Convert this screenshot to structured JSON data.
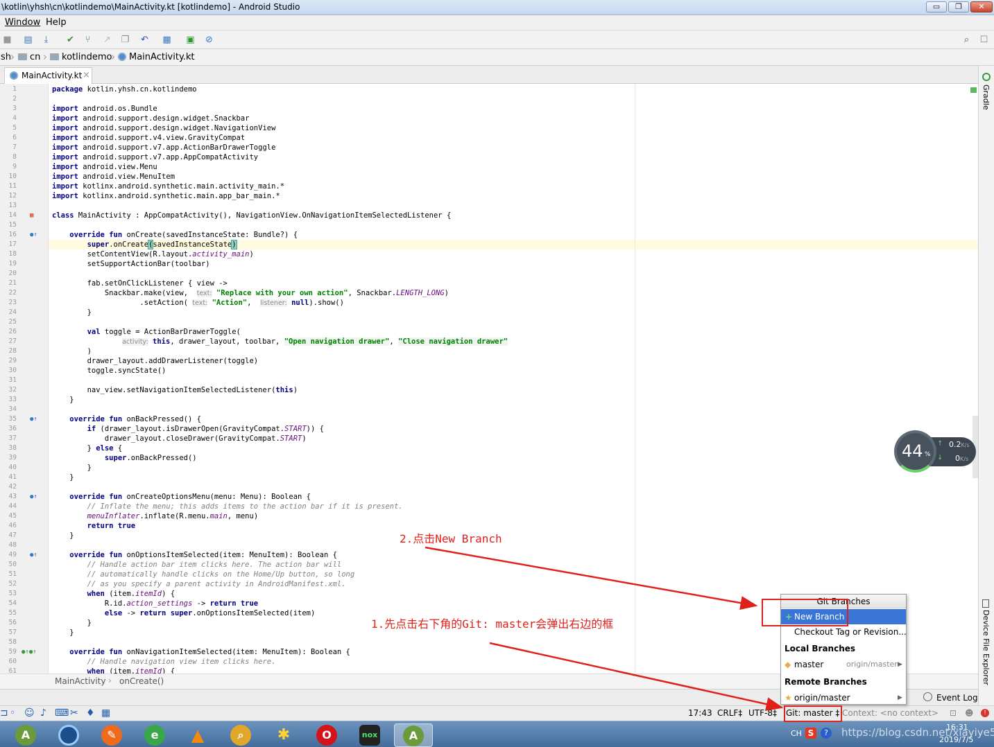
{
  "window": {
    "title": "\\kotlin\\yhsh\\cn\\kotlindemo\\MainActivity.kt [kotlindemo] - Android Studio",
    "btn_min": "▭",
    "btn_max": "❐",
    "btn_close": "✕"
  },
  "menu": {
    "items": [
      "Window",
      "Help"
    ]
  },
  "breadcrumb": {
    "items": [
      "sh",
      "cn",
      "kotlindemo",
      "MainActivity.kt"
    ]
  },
  "editor_tab": {
    "label": "MainActivity.kt",
    "close": "×"
  },
  "right_strip": {
    "gradle": "Gradle",
    "device_explorer": "Device File Explorer"
  },
  "code_lines": [
    {
      "n": "1",
      "gi": "",
      "h": "<span class='kw'>package</span> kotlin.yhsh.cn.kotlindemo"
    },
    {
      "n": "2",
      "gi": "",
      "h": ""
    },
    {
      "n": "3",
      "gi": "",
      "h": "<span class='kw'>import</span> android.os.Bundle"
    },
    {
      "n": "4",
      "gi": "",
      "h": "<span class='kw'>import</span> android.support.design.widget.Snackbar"
    },
    {
      "n": "5",
      "gi": "",
      "h": "<span class='kw'>import</span> android.support.design.widget.NavigationView"
    },
    {
      "n": "6",
      "gi": "",
      "h": "<span class='kw'>import</span> android.support.v4.view.GravityCompat"
    },
    {
      "n": "7",
      "gi": "",
      "h": "<span class='kw'>import</span> android.support.v7.app.ActionBarDrawerToggle"
    },
    {
      "n": "8",
      "gi": "",
      "h": "<span class='kw'>import</span> android.support.v7.app.AppCompatActivity"
    },
    {
      "n": "9",
      "gi": "",
      "h": "<span class='kw'>import</span> android.view.Menu"
    },
    {
      "n": "10",
      "gi": "",
      "h": "<span class='kw'>import</span> android.view.MenuItem"
    },
    {
      "n": "11",
      "gi": "",
      "h": "<span class='kw'>import</span> kotlinx.android.synthetic.main.activity_main.*"
    },
    {
      "n": "12",
      "gi": "",
      "h": "<span class='kw'>import</span> kotlinx.android.synthetic.main.app_bar_main.*"
    },
    {
      "n": "13",
      "gi": "",
      "h": ""
    },
    {
      "n": "14",
      "gi": "c",
      "h": "<span class='kw'>class</span> MainActivity : AppCompatActivity(), NavigationView.OnNavigationItemSelectedListener {"
    },
    {
      "n": "15",
      "gi": "",
      "h": ""
    },
    {
      "n": "16",
      "gi": "o",
      "h": "    <span class='kw'>override fun</span> onCreate(savedInstanceState: Bundle?) {"
    },
    {
      "n": "17",
      "gi": "",
      "h": "        <span class='kw'>super</span>.onCreate<span class='hl'>(</span>savedInstanceState<span class='hl'>)</span>"
    },
    {
      "n": "18",
      "gi": "",
      "h": "        setContentView(R.layout.<span class='it'>activity_main</span>)"
    },
    {
      "n": "19",
      "gi": "",
      "h": "        setSupportActionBar(toolbar)"
    },
    {
      "n": "20",
      "gi": "",
      "h": ""
    },
    {
      "n": "21",
      "gi": "",
      "h": "        fab.setOnClickListener { view -&gt;"
    },
    {
      "n": "22",
      "gi": "",
      "h": "            Snackbar.make(view,  <span class='hint'>text:</span> <span class='str'>\"Replace with your own action\"</span>, Snackbar.<span class='it'>LENGTH_LONG</span>)"
    },
    {
      "n": "23",
      "gi": "",
      "h": "                    .setAction( <span class='hint'>text:</span> <span class='str'>\"Action\"</span>,  <span class='hint'>listener:</span> <span class='kw'>null</span>).show()"
    },
    {
      "n": "24",
      "gi": "",
      "h": "        }"
    },
    {
      "n": "25",
      "gi": "",
      "h": ""
    },
    {
      "n": "26",
      "gi": "",
      "h": "        <span class='kw'>val</span> toggle = ActionBarDrawerToggle("
    },
    {
      "n": "27",
      "gi": "",
      "h": "                <span class='hint'>activity:</span> <span class='kw'>this</span>, drawer_layout, toolbar, <span class='str sbg'>\"Open navigation drawer\"</span>, <span class='str sbg'>\"Close navigation drawer\"</span>"
    },
    {
      "n": "28",
      "gi": "",
      "h": "        )"
    },
    {
      "n": "29",
      "gi": "",
      "h": "        drawer_layout.addDrawerListener(toggle)"
    },
    {
      "n": "30",
      "gi": "",
      "h": "        toggle.syncState()"
    },
    {
      "n": "31",
      "gi": "",
      "h": ""
    },
    {
      "n": "32",
      "gi": "",
      "h": "        nav_view.setNavigationItemSelectedListener(<span class='kw'>this</span>)"
    },
    {
      "n": "33",
      "gi": "",
      "h": "    }"
    },
    {
      "n": "34",
      "gi": "",
      "h": ""
    },
    {
      "n": "35",
      "gi": "o",
      "h": "    <span class='kw'>override fun</span> onBackPressed() {"
    },
    {
      "n": "36",
      "gi": "",
      "h": "        <span class='kw'>if</span> (drawer_layout.isDrawerOpen(GravityCompat.<span class='it'>START</span>)) {"
    },
    {
      "n": "37",
      "gi": "",
      "h": "            drawer_layout.closeDrawer(GravityCompat.<span class='it'>START</span>)"
    },
    {
      "n": "38",
      "gi": "",
      "h": "        } <span class='kw'>else</span> {"
    },
    {
      "n": "39",
      "gi": "",
      "h": "            <span class='kw'>super</span>.onBackPressed()"
    },
    {
      "n": "40",
      "gi": "",
      "h": "        }"
    },
    {
      "n": "41",
      "gi": "",
      "h": "    }"
    },
    {
      "n": "42",
      "gi": "",
      "h": ""
    },
    {
      "n": "43",
      "gi": "o",
      "h": "    <span class='kw'>override fun</span> onCreateOptionsMenu(menu: Menu): Boolean {"
    },
    {
      "n": "44",
      "gi": "",
      "h": "        <span class='cmt'>// Inflate the menu; this adds items to the action bar if it is present.</span>"
    },
    {
      "n": "45",
      "gi": "",
      "h": "        <span class='it'>menuInflater</span>.inflate(R.menu.<span class='it'>main</span>, menu)"
    },
    {
      "n": "46",
      "gi": "",
      "h": "        <span class='kw'>return true</span>"
    },
    {
      "n": "47",
      "gi": "",
      "h": "    }"
    },
    {
      "n": "48",
      "gi": "",
      "h": ""
    },
    {
      "n": "49",
      "gi": "o",
      "h": "    <span class='kw'>override fun</span> onOptionsItemSelected(item: MenuItem): Boolean {"
    },
    {
      "n": "50",
      "gi": "",
      "h": "        <span class='cmt'>// Handle action bar item clicks here. The action bar will</span>"
    },
    {
      "n": "51",
      "gi": "",
      "h": "        <span class='cmt'>// automatically handle clicks on the Home/Up button, so long</span>"
    },
    {
      "n": "52",
      "gi": "",
      "h": "        <span class='cmt'>// as you specify a parent activity in AndroidManifest.xml.</span>"
    },
    {
      "n": "53",
      "gi": "",
      "h": "        <span class='kw'>when</span> (item.<span class='it'>itemId</span>) {"
    },
    {
      "n": "54",
      "gi": "",
      "h": "            R.id.<span class='it'>action_settings</span> -&gt; <span class='kw'>return true</span>"
    },
    {
      "n": "55",
      "gi": "",
      "h": "            <span class='kw'>else</span> -&gt; <span class='kw'>return super</span>.onOptionsItemSelected(item)"
    },
    {
      "n": "56",
      "gi": "",
      "h": "        }"
    },
    {
      "n": "57",
      "gi": "",
      "h": "    }"
    },
    {
      "n": "58",
      "gi": "",
      "h": ""
    },
    {
      "n": "59",
      "gi": "oo",
      "h": "    <span class='kw'>override fun</span> onNavigationItemSelected(item: MenuItem): Boolean {"
    },
    {
      "n": "60",
      "gi": "",
      "h": "        <span class='cmt'>// Handle navigation view item clicks here.</span>"
    },
    {
      "n": "61",
      "gi": "",
      "h": "        <span class='kw'>when</span> (item.<span class='it'>itemId</span>) {"
    }
  ],
  "editor_breadcrumb": {
    "class": "MainActivity",
    "sep": "›",
    "method": "onCreate()"
  },
  "statusbar": {
    "position": "17:43",
    "line_sep": "CRLF‡",
    "encoding": "UTF-8‡",
    "git": "Git: master ‡",
    "context": "Context: <no context>",
    "event_log": "Event Log"
  },
  "git_popup": {
    "title": "Git Branches",
    "new_branch": "New Branch",
    "checkout": "Checkout Tag or Revision...",
    "local_header": "Local Branches",
    "local_branch": "master",
    "local_tracking": "origin/master",
    "remote_header": "Remote Branches",
    "remote_branch": "origin/master"
  },
  "net_meter": {
    "percent": "44",
    "unit": "%",
    "up": "0.2",
    "down": "0",
    "speed_unit": "K/s"
  },
  "annotations": {
    "step1": "1.先点击右下角的Git: master会弹出右边的框",
    "step2": "2.点击New Branch"
  },
  "taskbar": {
    "ime": "CH",
    "watermark": "https://blog.csdn.net/xiayiye5",
    "time": "16:31",
    "date": "2019/7/5"
  }
}
